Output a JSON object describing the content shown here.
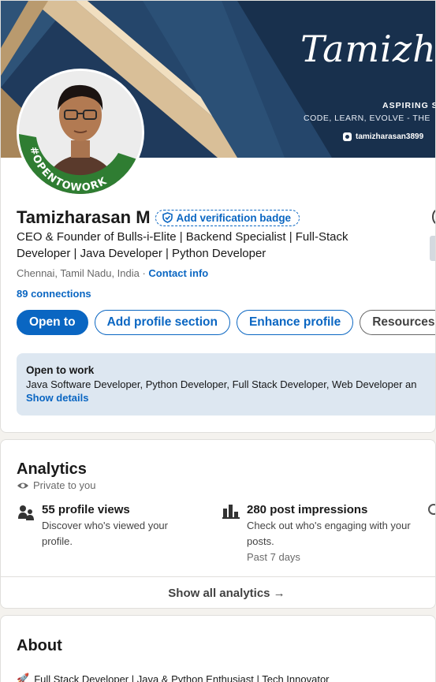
{
  "banner": {
    "signature": "Tamizharasan",
    "aspiring": "ASPIRING S",
    "tagline": "CODE, LEARN, EVOLVE - THE",
    "handle": "tamizharasan3899"
  },
  "avatar": {
    "badge_text": "#OPENTOWORK"
  },
  "profile": {
    "name": "Tamizharasan M",
    "verify_label": "Add verification badge",
    "headline": "CEO & Founder of Bulls-i-Elite | Backend Specialist | Full-Stack Developer | Java Developer | Python Developer",
    "location": "Chennai, Tamil Nadu, India · ",
    "contact_info": "Contact info",
    "connections": "89 connections"
  },
  "actions": {
    "open_to": "Open to",
    "add_section": "Add profile section",
    "enhance": "Enhance profile",
    "resources": "Resources"
  },
  "open_to_work": {
    "title": "Open to work",
    "roles": "Java Software Developer, Python Developer, Full Stack Developer, Web Developer an",
    "show_details": "Show details"
  },
  "analytics": {
    "title": "Analytics",
    "private": "Private to you",
    "profile_views": {
      "title": "55 profile views",
      "desc": "Discover who's viewed your profile."
    },
    "impressions": {
      "title": "280 post impressions",
      "desc": "Check out who's engaging with your posts.",
      "period": "Past 7 days"
    },
    "show_all": "Show all analytics →"
  },
  "about": {
    "title": "About",
    "text": "Full Stack Developer | Java & Python Enthusiast | Tech Innovator"
  },
  "colors": {
    "brand": "#0a66c2",
    "open_to_work_green": "#2f7d32",
    "banner_navy": "#1e3553"
  }
}
